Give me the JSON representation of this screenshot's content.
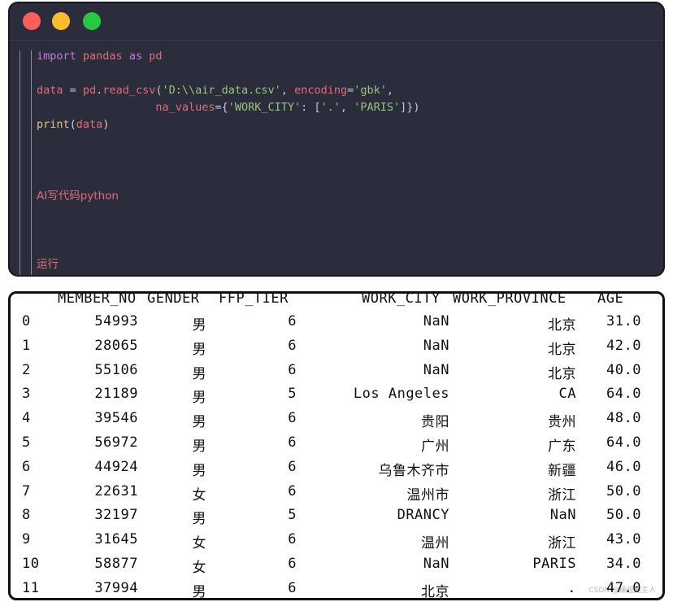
{
  "editor": {
    "lines": [
      [
        {
          "t": "import ",
          "c": "kw"
        },
        {
          "t": "pandas ",
          "c": "id"
        },
        {
          "t": "as ",
          "c": "kw"
        },
        {
          "t": "pd",
          "c": "id"
        }
      ],
      [],
      [
        {
          "t": "data ",
          "c": "id"
        },
        {
          "t": "= ",
          "c": "pn"
        },
        {
          "t": "pd",
          "c": "id"
        },
        {
          "t": ".",
          "c": "pn"
        },
        {
          "t": "read_csv",
          "c": "id"
        },
        {
          "t": "(",
          "c": "pn"
        },
        {
          "t": "'D:\\\\air_data.csv'",
          "c": "str"
        },
        {
          "t": ", ",
          "c": "pn"
        },
        {
          "t": "encoding",
          "c": "id"
        },
        {
          "t": "=",
          "c": "pn"
        },
        {
          "t": "'gbk'",
          "c": "str"
        },
        {
          "t": ",",
          "c": "pn"
        }
      ],
      [
        {
          "t": "                  ",
          "c": "pn"
        },
        {
          "t": "na_values",
          "c": "id"
        },
        {
          "t": "={",
          "c": "pn"
        },
        {
          "t": "'WORK_CITY'",
          "c": "str"
        },
        {
          "t": ": [",
          "c": "pn"
        },
        {
          "t": "'.'",
          "c": "str"
        },
        {
          "t": ", ",
          "c": "pn"
        },
        {
          "t": "'PARIS'",
          "c": "str"
        },
        {
          "t": "]})",
          "c": "pn"
        }
      ],
      [
        {
          "t": "print",
          "c": "fn"
        },
        {
          "t": "(",
          "c": "pn"
        },
        {
          "t": "data",
          "c": "id"
        },
        {
          "t": ")",
          "c": "pn"
        }
      ],
      [],
      [],
      [],
      [
        {
          "t": "AI写代码python",
          "c": "comment"
        }
      ],
      [],
      [],
      [],
      [
        {
          "t": "运行",
          "c": "comment"
        }
      ]
    ]
  },
  "output": {
    "columns": [
      "MEMBER_NO",
      "GENDER",
      "FFP_TIER",
      "WORK_CITY",
      "WORK_PROVINCE",
      "AGE"
    ],
    "rows": [
      [
        "0",
        "54993",
        "男",
        "6",
        "NaN",
        "北京",
        "31.0"
      ],
      [
        "1",
        "28065",
        "男",
        "6",
        "NaN",
        "北京",
        "42.0"
      ],
      [
        "2",
        "55106",
        "男",
        "6",
        "NaN",
        "北京",
        "40.0"
      ],
      [
        "3",
        "21189",
        "男",
        "5",
        "Los Angeles",
        "CA",
        "64.0"
      ],
      [
        "4",
        "39546",
        "男",
        "6",
        "贵阳",
        "贵州",
        "48.0"
      ],
      [
        "5",
        "56972",
        "男",
        "6",
        "广州",
        "广东",
        "64.0"
      ],
      [
        "6",
        "44924",
        "男",
        "6",
        "乌鲁木齐市",
        "新疆",
        "46.0"
      ],
      [
        "7",
        "22631",
        "女",
        "6",
        "温州市",
        "浙江",
        "50.0"
      ],
      [
        "8",
        "32197",
        "男",
        "5",
        "DRANCY",
        "NaN",
        "50.0"
      ],
      [
        "9",
        "31645",
        "女",
        "6",
        "温州",
        "浙江",
        "43.0"
      ],
      [
        "10",
        "58877",
        "女",
        "6",
        "NaN",
        "PARIS",
        "34.0"
      ],
      [
        "11",
        "37994",
        "男",
        "6",
        "北京",
        ".",
        "47.0"
      ]
    ]
  },
  "watermark": "CSDN @编程鬼主人"
}
